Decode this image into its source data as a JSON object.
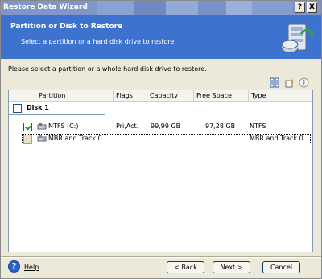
{
  "window": {
    "title": "Restore Data Wizard",
    "help_glyph": "?",
    "close_glyph": "X"
  },
  "header": {
    "title": "Partition or Disk to Restore",
    "subtitle": "Select a partition or a hard disk drive to restore."
  },
  "instruction": "Please select a partition or a whole hard disk drive to restore.",
  "table": {
    "columns": [
      "Partition",
      "Flags",
      "Capacity",
      "Free Space",
      "Type"
    ],
    "disk": {
      "label": "Disk 1",
      "checked": false
    },
    "rows": [
      {
        "partition": "NTFS (C:)",
        "flags": "Pri,Act.",
        "capacity": "99,99 GB",
        "free_space": "97,28 GB",
        "type": "NTFS",
        "checked": true
      },
      {
        "partition": "MBR and Track 0",
        "flags": "",
        "capacity": "",
        "free_space": "",
        "type": "MBR and Track 0",
        "checked": false
      }
    ]
  },
  "footer": {
    "help_label": "Help",
    "back_label": "< Back",
    "next_label": "Next >",
    "cancel_label": "Cancel"
  },
  "colors": {
    "header_bg": "#3d73cf",
    "title_bar": "#7f97c8",
    "window_bg": "#ece9d8"
  }
}
